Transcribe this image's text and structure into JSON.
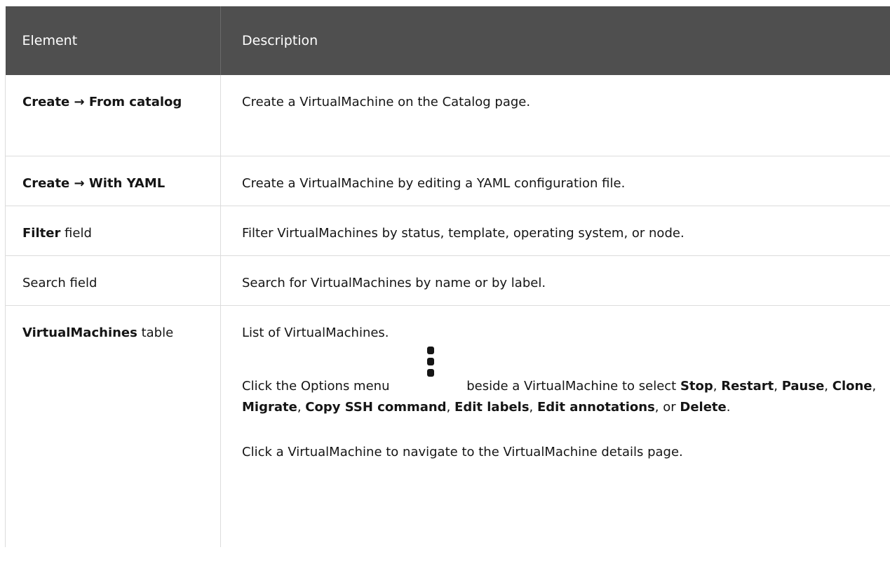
{
  "table": {
    "headers": {
      "element": "Element",
      "description": "Description"
    },
    "rows": [
      {
        "element_bold": "Create → From catalog",
        "element_rest": "",
        "description": "Create a VirtualMachine on the Catalog page."
      },
      {
        "element_bold": "Create → With YAML",
        "element_rest": "",
        "description": "Create a VirtualMachine by editing a YAML configuration file."
      },
      {
        "element_bold": "Filter",
        "element_rest": " field",
        "description": "Filter VirtualMachines by status, template, operating system, or node."
      },
      {
        "element_bold": "",
        "element_rest": "Search field",
        "description": "Search for VirtualMachines by name or by label."
      },
      {
        "element_bold": "VirtualMachines",
        "element_rest": " table",
        "description": "List of VirtualMachines.",
        "options_text": {
          "before_icon": "Click the Options menu",
          "after_icon": " beside a VirtualMachine to select ",
          "icon": "kebab-icon",
          "actions": [
            "Stop",
            "Restart",
            "Pause",
            "Clone",
            "Migrate",
            "Copy SSH command",
            "Edit labels",
            "Edit annotations",
            "Delete"
          ],
          "sep": ", ",
          "or": ", or ",
          "end": "."
        },
        "navigate_text": "Click a VirtualMachine to navigate to the VirtualMachine details page."
      }
    ]
  }
}
